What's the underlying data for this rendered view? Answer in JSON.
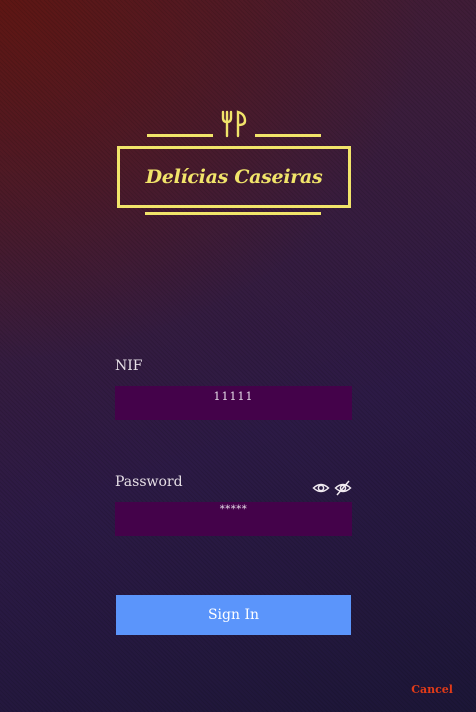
{
  "brand": {
    "name": "Delícias Caseiras",
    "logo_icon": "fork-knife-icon",
    "accent_color": "#f1e46a"
  },
  "form": {
    "nif_label": "NIF",
    "nif_value": "11111",
    "password_label": "Password",
    "password_value": "*****",
    "show_password_icon": "eye-icon",
    "hide_password_icon": "eye-off-icon",
    "field_color": "#44024a"
  },
  "actions": {
    "sign_in_label": "Sign In",
    "sign_in_color": "#5b95fb",
    "cancel_label": "Cancel",
    "cancel_color": "#e23b18"
  }
}
